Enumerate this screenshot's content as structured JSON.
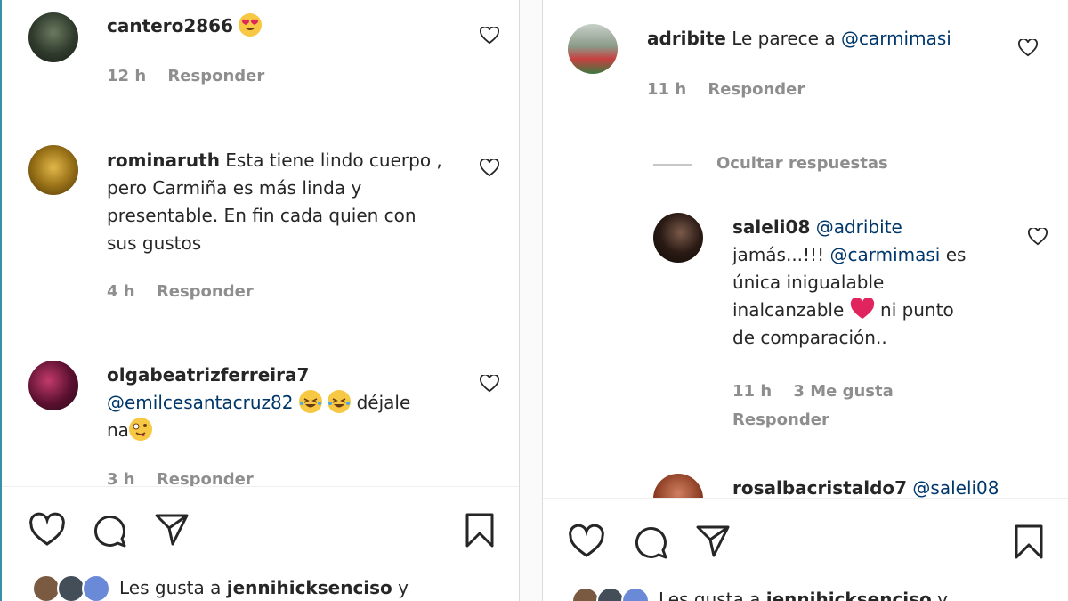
{
  "left": {
    "comments": [
      {
        "user": "cantero2866",
        "text": "",
        "time": "12 h",
        "reply": "Responder"
      },
      {
        "user": "rominaruth",
        "text": "Esta tiene lindo cuerpo , pero Carmiña es más linda y presentable. En fin cada quien con sus gustos",
        "line1": "Esta tiene lindo cuerpo ,",
        "line2": "pero Carmiña es más linda y",
        "line3": "presentable. En fin cada quien con",
        "line4": "sus gustos",
        "time": "4 h",
        "reply": "Responder"
      },
      {
        "user": "olgabeatrizferreira7",
        "mention": "@emilcesantacruz82",
        "text_after": "déjale",
        "line3": "na",
        "time": "3 h",
        "reply": "Responder"
      }
    ],
    "likes": {
      "prefix": "Les gusta a",
      "user": "jennihicksenciso",
      "suffix": "y"
    }
  },
  "right": {
    "comments": [
      {
        "user": "adribite",
        "text": "Le parece a",
        "mention": "@carmimasi",
        "time": "11 h",
        "reply": "Responder"
      }
    ],
    "hide_replies": "Ocultar respuestas",
    "reply": {
      "user": "saleli08",
      "mention1": "@adribite",
      "line2_text": "jamás...!!!",
      "mention2": "@carmimasi",
      "line2_end": "es",
      "line3": "única inigualable",
      "line4_start": "inalcanzable",
      "line4_end": "ni punto",
      "line5": "de comparación..",
      "time": "11 h",
      "likes": "3 Me gusta",
      "reply": "Responder"
    },
    "next": {
      "user": "rosalbacristaldo7",
      "mention": "@saleli08"
    },
    "likes": {
      "prefix": "Les gusta a",
      "user": "jennihicksenciso",
      "suffix": "y"
    }
  },
  "icons": [
    "heart-icon",
    "comment-icon",
    "share-icon",
    "bookmark-icon"
  ],
  "colors": {
    "text": "#262626",
    "muted": "#8e8e8e",
    "mention": "#00376b",
    "red_heart": "#e0245e"
  }
}
